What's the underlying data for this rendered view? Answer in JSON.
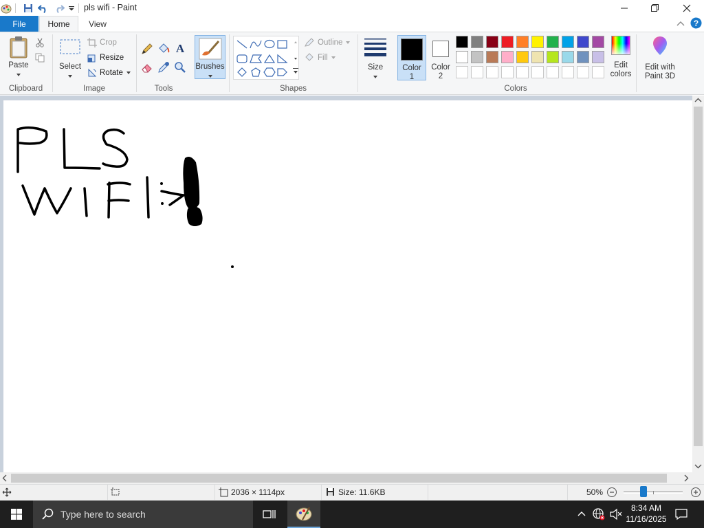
{
  "window": {
    "title": "pls wifi - Paint",
    "minimize_icon": "minimize-icon",
    "maximize_icon": "restore-icon",
    "close_icon": "close-icon"
  },
  "tabs": {
    "file": "File",
    "home": "Home",
    "view": "View"
  },
  "ribbon": {
    "clipboard": {
      "paste": "Paste",
      "group": "Clipboard"
    },
    "image": {
      "select": "Select",
      "crop": "Crop",
      "resize": "Resize",
      "rotate": "Rotate",
      "group": "Image"
    },
    "tools": {
      "group": "Tools"
    },
    "brushes": {
      "label": "Brushes"
    },
    "shapes": {
      "outline": "Outline",
      "fill": "Fill",
      "group": "Shapes"
    },
    "size": {
      "label": "Size"
    },
    "color1": {
      "label": "Color",
      "num": "1"
    },
    "color2": {
      "label": "Color",
      "num": "2"
    },
    "colors": {
      "group": "Colors",
      "row1": [
        "#000000",
        "#7f7f7f",
        "#880015",
        "#ed1c24",
        "#ff7f27",
        "#fff200",
        "#22b14c",
        "#00a2e8",
        "#3f48cc",
        "#a349a4"
      ],
      "row2": [
        "#ffffff",
        "#c3c3c3",
        "#b97a57",
        "#ffaec9",
        "#ffc90e",
        "#efe4b0",
        "#b5e61d",
        "#99d9ea",
        "#7092be",
        "#c8bfe7"
      ],
      "row3": [
        "#ffffff",
        "#ffffff",
        "#ffffff",
        "#ffffff",
        "#ffffff",
        "#ffffff",
        "#ffffff",
        "#ffffff",
        "#ffffff",
        "#ffffff"
      ]
    },
    "edit_colors": {
      "line1": "Edit",
      "line2": "colors"
    },
    "paint3d": {
      "line1": "Edit with",
      "line2": "Paint 3D"
    }
  },
  "status": {
    "dimensions": "2036 × 1114px",
    "size": "Size: 11.6KB",
    "zoom": "50%",
    "zoom_level": 0.5
  },
  "taskbar": {
    "search_placeholder": "Type here to search",
    "time": "8:34 AM",
    "date": "11/16/2025"
  }
}
